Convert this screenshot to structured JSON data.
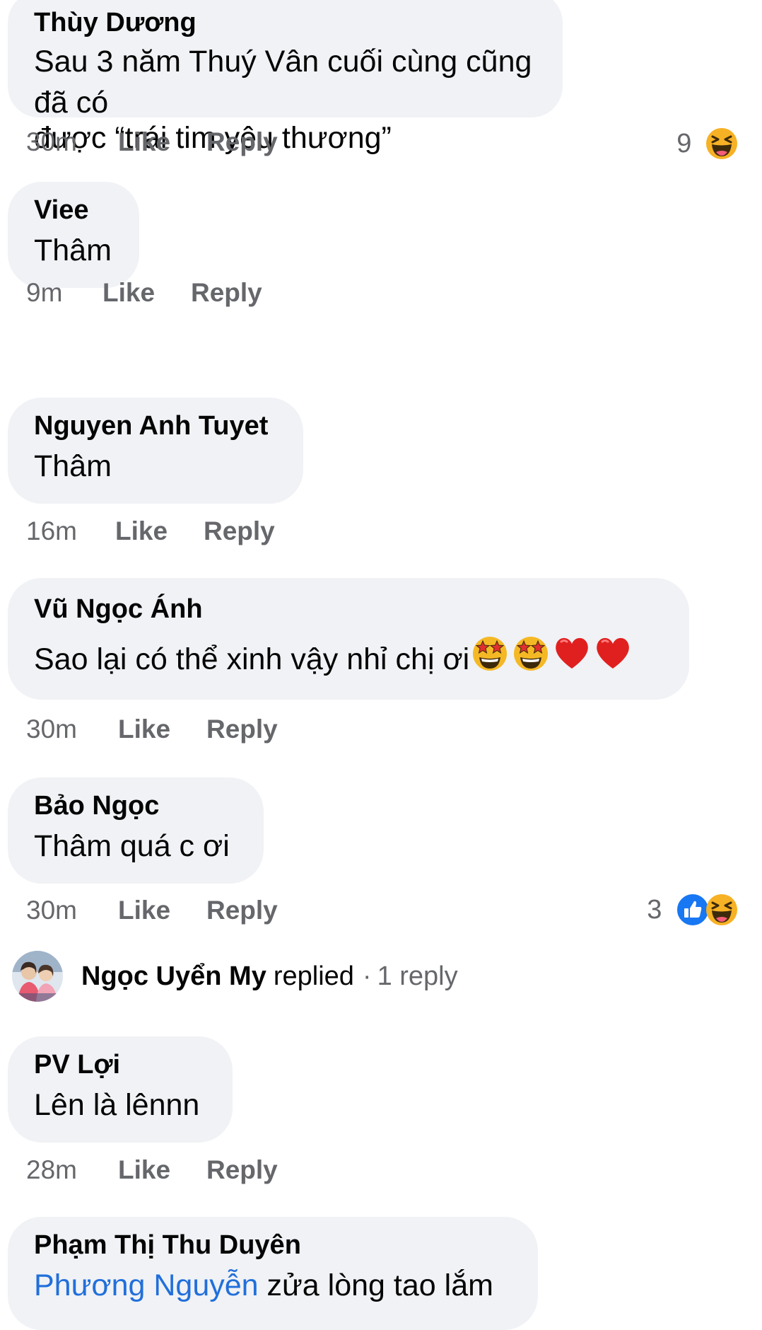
{
  "comments": [
    {
      "author": "Thùy Dương",
      "line1": "Sau 3 năm Thuý Vân cuối cùng cũng đã có",
      "line2": "được “trái tim yêu thương”",
      "time": "30m",
      "like": "Like",
      "reply": "Reply",
      "reaction_count": "9",
      "reactions": [
        "haha-icon"
      ]
    },
    {
      "author": "Viee",
      "text": "Thâm",
      "time": "9m",
      "like": "Like",
      "reply": "Reply"
    },
    {
      "author": "Nguyen Anh Tuyet",
      "text": "Thâm",
      "time": "16m",
      "like": "Like",
      "reply": "Reply"
    },
    {
      "author": "Vũ Ngọc Ánh",
      "text": "Sao lại có thể xinh vậy nhỉ chị ơi",
      "emoji": [
        "star-struck-icon",
        "star-struck-icon",
        "heart-icon",
        "heart-icon"
      ],
      "time": "30m",
      "like": "Like",
      "reply": "Reply"
    },
    {
      "author": "Bảo Ngọc",
      "text": "Thâm quá c ơi",
      "time": "30m",
      "like": "Like",
      "reply": "Reply",
      "reaction_count": "3",
      "reactions": [
        "like-icon",
        "haha-icon"
      ]
    },
    {
      "author": "PV Lợi",
      "text": "Lên là lênnn",
      "time": "28m",
      "like": "Like",
      "reply": "Reply"
    },
    {
      "author": "Phạm Thị Thu Duyên",
      "mention": "Phương Nguyễn",
      "text": " zửa lòng tao lắm"
    }
  ],
  "reply_summary": {
    "name": "Ngọc Uyển My",
    "action": "replied",
    "separator": "·",
    "count": "1 reply"
  },
  "colors": {
    "bubble": "#f0f2f5",
    "meta": "#65676b",
    "mention": "#216fdb",
    "like_blue": "#1877f2",
    "haha_yellow": "#f7b125",
    "heart_red": "#e0201f"
  }
}
